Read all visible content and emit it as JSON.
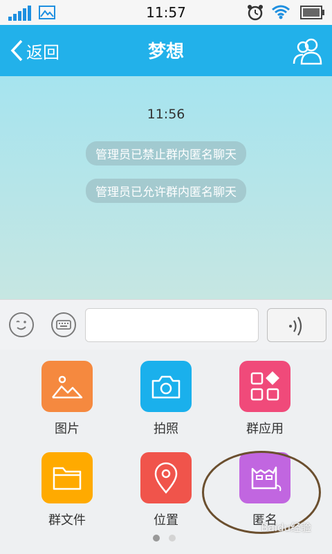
{
  "status_bar": {
    "time": "11:57"
  },
  "nav": {
    "back_label": "返回",
    "title": "梦想"
  },
  "chat": {
    "time": "11:56",
    "messages": [
      "管理员已禁止群内匿名聊天",
      "管理员已允许群内匿名聊天"
    ]
  },
  "input": {
    "placeholder": ""
  },
  "panel": {
    "tiles": [
      {
        "label": "图片",
        "icon": "picture-icon",
        "color": "#f5893f"
      },
      {
        "label": "拍照",
        "icon": "camera-icon",
        "color": "#1ab0ec"
      },
      {
        "label": "群应用",
        "icon": "apps-icon",
        "color": "#f04a7a"
      },
      {
        "label": "群文件",
        "icon": "folder-icon",
        "color": "#ffaa00"
      },
      {
        "label": "位置",
        "icon": "location-icon",
        "color": "#f0544b"
      },
      {
        "label": "匿名",
        "icon": "anonymous-icon",
        "color": "#c166e0"
      }
    ],
    "page_count": 2,
    "current_page": 1
  },
  "colors": {
    "nav_bar": "#22b1ea",
    "signal": "#1e8fe0"
  },
  "watermark": "Baidu经验"
}
